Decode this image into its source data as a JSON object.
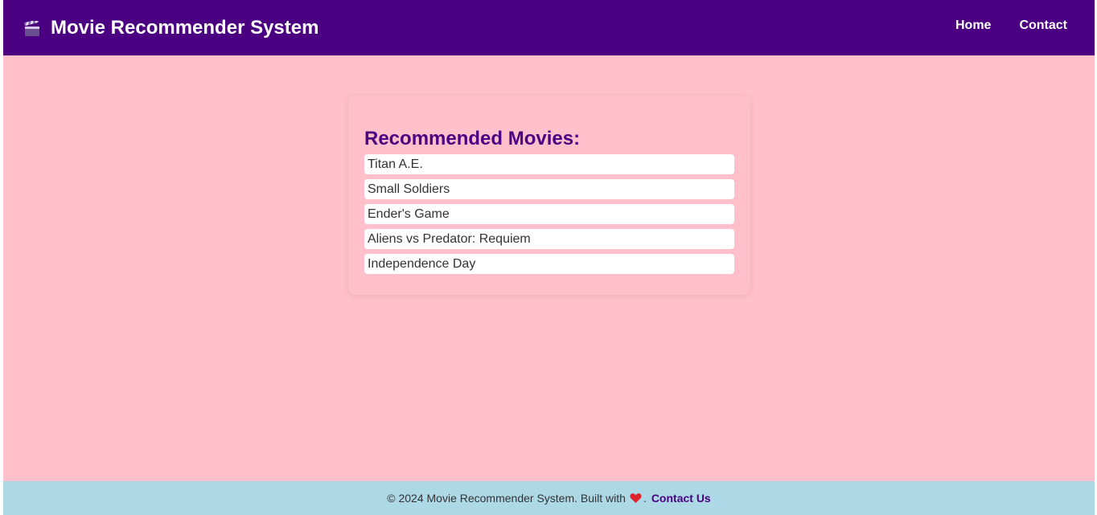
{
  "header": {
    "icon": "clapperboard-icon",
    "title": "Movie Recommender System",
    "nav": [
      {
        "label": "Home"
      },
      {
        "label": "Contact"
      }
    ],
    "background": "#4b0082"
  },
  "main": {
    "background": "#ffc0cb",
    "heading": "Recommended Movies:",
    "movies": [
      "Titan A.E.",
      "Small Soldiers",
      "Ender's Game",
      "Aliens vs Predator: Requiem",
      "Independence Day"
    ]
  },
  "footer": {
    "background": "#add8e6",
    "text_before": "© 2024 Movie Recommender System. Built with",
    "icon": "heart-icon",
    "text_after": ".",
    "link": "Contact Us"
  }
}
